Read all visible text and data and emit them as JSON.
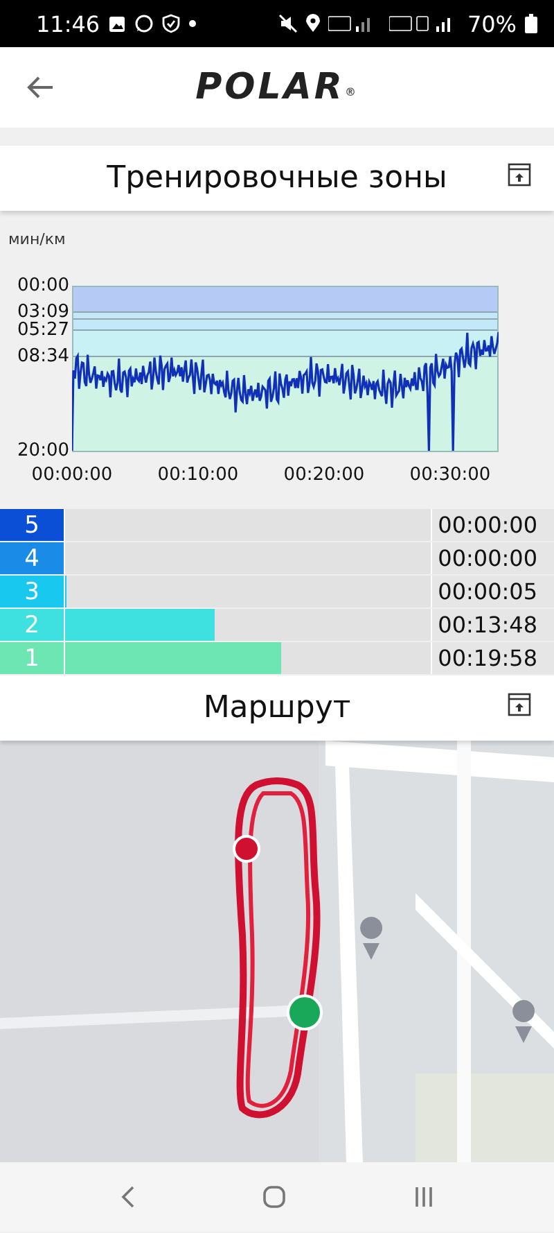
{
  "status_bar": {
    "time": "11:46",
    "battery": "70%"
  },
  "header": {
    "logo": "POLAR",
    "logo_mark": "®"
  },
  "zones_section": {
    "title": "Тренировочные зоны",
    "chart": {
      "unit": "мин/км",
      "yticks": [
        "00:00",
        "03:09",
        "05:27",
        "08:34",
        "20:00"
      ],
      "xticks": [
        "00:00:00",
        "00:10:00",
        "00:20:00",
        "00:30:00"
      ]
    },
    "zones": [
      {
        "number": "5",
        "color": "#0a4fd6",
        "level": 0,
        "time": "00:00:00"
      },
      {
        "number": "4",
        "color": "#1a8be6",
        "level": 0,
        "time": "00:00:00"
      },
      {
        "number": "3",
        "color": "#18c8ee",
        "level": 0.004,
        "time": "00:00:05"
      },
      {
        "number": "2",
        "color": "#3fe0e0",
        "level": 0.41,
        "time": "00:13:48"
      },
      {
        "number": "1",
        "color": "#6ee6b4",
        "level": 0.59,
        "time": "00:19:58"
      }
    ]
  },
  "route_section": {
    "title": "Маршрут"
  }
}
